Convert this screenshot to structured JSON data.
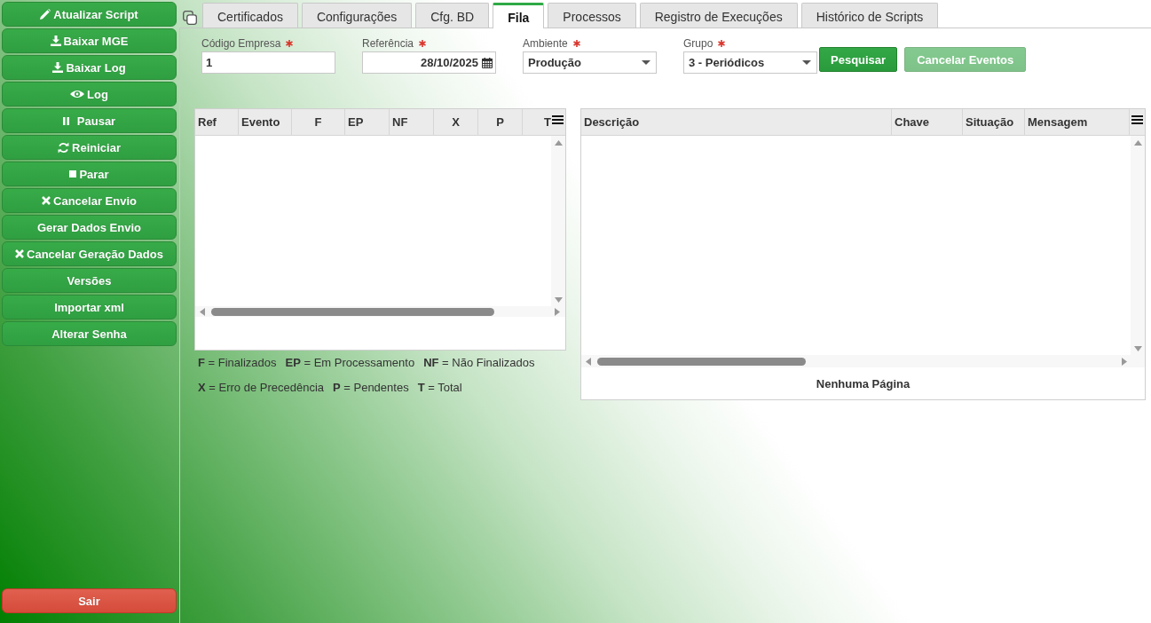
{
  "sidebar": {
    "buttons": [
      {
        "label": "Atualizar Script",
        "kind": "edit"
      },
      {
        "label": "Baixar MGE",
        "kind": "download"
      },
      {
        "label": "Baixar Log",
        "kind": "download"
      },
      {
        "label": "Log",
        "kind": "view"
      },
      {
        "label": "Pausar",
        "kind": "pause"
      },
      {
        "label": "Reiniciar",
        "kind": "restart"
      },
      {
        "label": "Parar",
        "kind": "stop"
      },
      {
        "label": "Cancelar Envio",
        "kind": "cancel"
      },
      {
        "label": "Gerar Dados Envio",
        "kind": "plain"
      },
      {
        "label": "Cancelar Geração Dados",
        "kind": "cancel"
      },
      {
        "label": "Versões",
        "kind": "plain"
      },
      {
        "label": "Importar xml",
        "kind": "plain"
      },
      {
        "label": "Alterar Senha",
        "kind": "plain"
      }
    ],
    "exit_button": {
      "label": "Sair"
    }
  },
  "tabs": [
    {
      "label": "Certificados",
      "selected": false
    },
    {
      "label": "Configurações",
      "selected": false
    },
    {
      "label": "Cfg. BD",
      "selected": false
    },
    {
      "label": "Fila",
      "selected": true
    },
    {
      "label": "Processos",
      "selected": false
    },
    {
      "label": "Registro de Execuções",
      "selected": false
    },
    {
      "label": "Histórico de Scripts",
      "selected": false
    }
  ],
  "filters": [
    {
      "label": "Código Empresa",
      "required": true,
      "kind": "text",
      "value": "1"
    },
    {
      "label": "Referência",
      "required": true,
      "kind": "date",
      "value": "28/10/2025"
    },
    {
      "label": "Ambiente",
      "required": true,
      "kind": "select",
      "value": "Produção"
    },
    {
      "label": "Grupo",
      "required": true,
      "kind": "select",
      "value": "3 - Periódicos"
    }
  ],
  "actions": [
    {
      "label": "Pesquisar",
      "disabled": false
    },
    {
      "label": "Cancelar Eventos",
      "disabled": true
    }
  ],
  "totals_grid": {
    "columns": [
      "Ref",
      "Evento",
      "F",
      "EP",
      "NF",
      "X",
      "P",
      "T"
    ]
  },
  "legend": [
    [
      "**F** = Finalizados",
      "**EP** = Em Processamento",
      "**NF** = Não Finalizados"
    ],
    [
      "**X** = Erro de Precedência",
      "**P** = Pendentes",
      "**T** = Total"
    ]
  ],
  "events_grid": {
    "columns": [
      "Descrição",
      "Chave",
      "Situação",
      "Mensagem"
    ],
    "pager": "Nenhuma Página"
  }
}
